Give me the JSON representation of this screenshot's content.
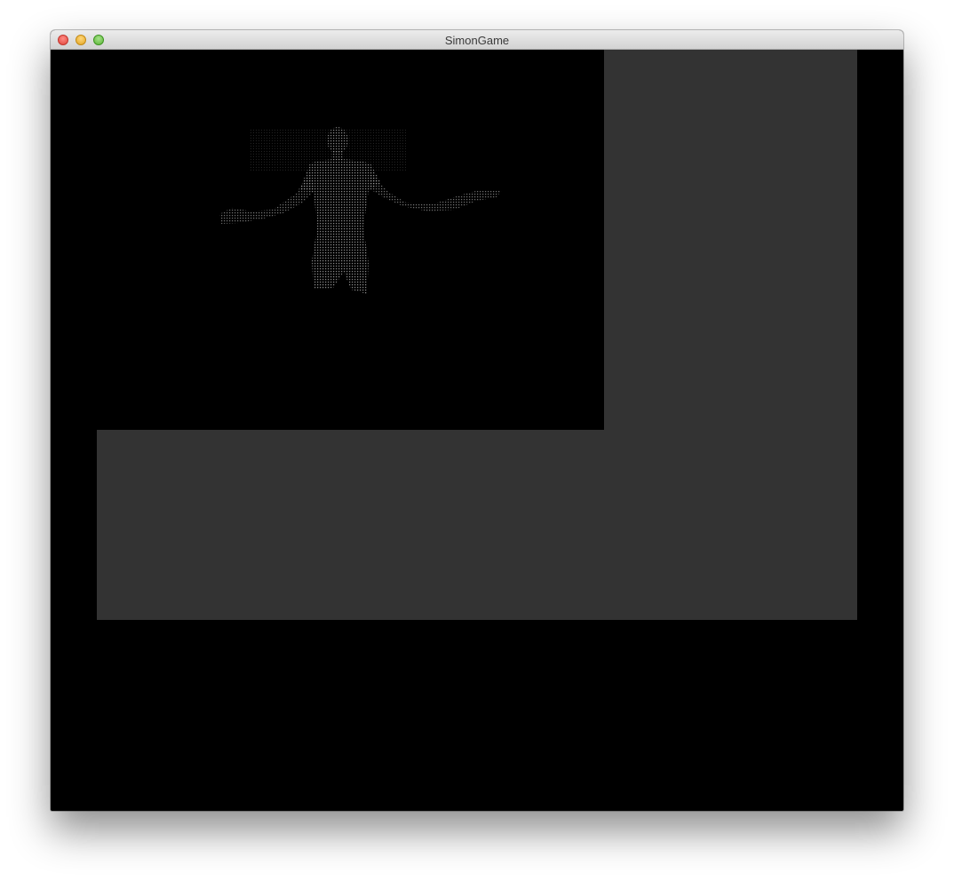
{
  "window": {
    "title": "SimonGame"
  },
  "titlebar": {
    "buttons": [
      "close",
      "minimize",
      "zoom"
    ]
  },
  "colors": {
    "background": "#000000",
    "panel": "#333333",
    "point_cloud": "#9a9a9a"
  },
  "depth_view": {
    "icon": "person-point-cloud-icon"
  }
}
